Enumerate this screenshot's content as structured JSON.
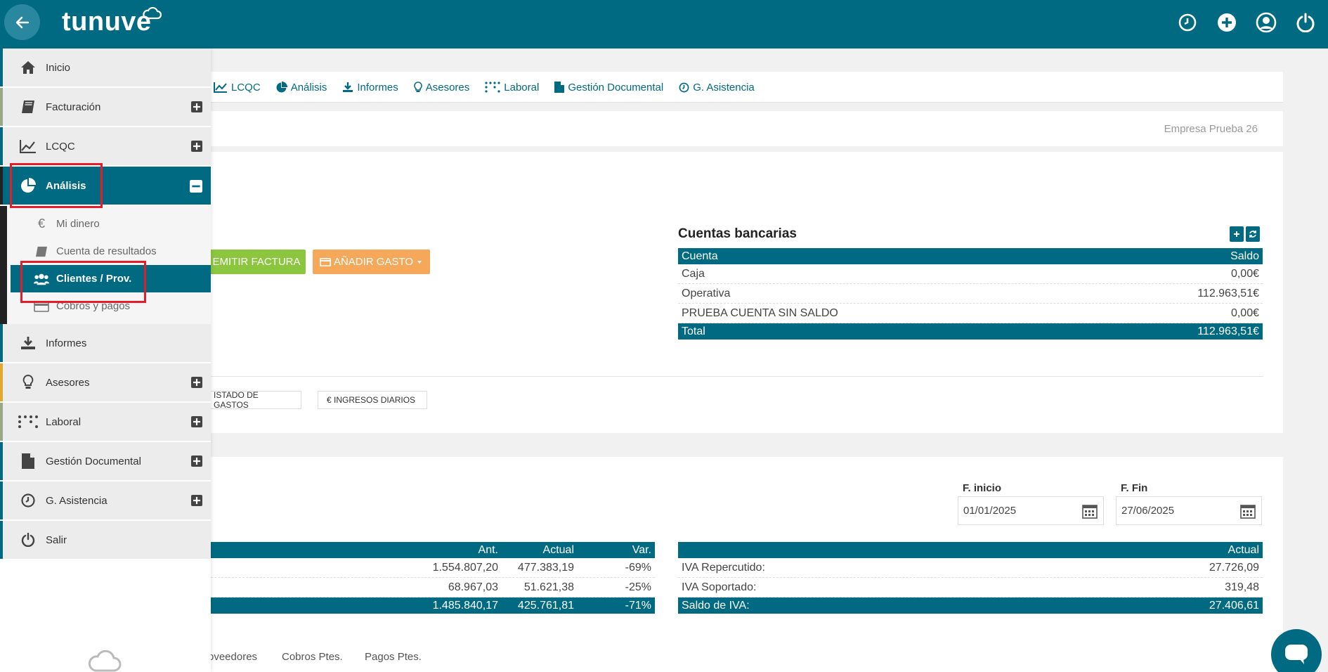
{
  "header": {
    "logo": "tunuve",
    "icons": [
      "clock-icon",
      "plus-circle-icon",
      "user-icon",
      "power-icon"
    ]
  },
  "nav": {
    "items": [
      {
        "label": "LCQC",
        "icon": "line-chart-icon"
      },
      {
        "label": "Análisis",
        "icon": "pie-chart-icon"
      },
      {
        "label": "Informes",
        "icon": "download-icon"
      },
      {
        "label": "Asesores",
        "icon": "lightbulb-icon"
      },
      {
        "label": "Laboral",
        "icon": "dots-grid-icon"
      },
      {
        "label": "Gestión Documental",
        "icon": "document-icon"
      },
      {
        "label": "G. Asistencia",
        "icon": "clock-icon"
      }
    ]
  },
  "company": {
    "name": "Empresa Prueba 26"
  },
  "actions": {
    "emitir": "EMITIR FACTURA",
    "gasto": "AÑADIR GASTO",
    "listado": "ISTADO DE GASTOS",
    "ingresos": "€ INGRESOS DIARIOS"
  },
  "bank": {
    "title": "Cuentas bancarias",
    "headers": {
      "cuenta": "Cuenta",
      "saldo": "Saldo"
    },
    "rows": [
      {
        "cuenta": "Caja",
        "saldo": "0,00€"
      },
      {
        "cuenta": "Operativa",
        "saldo": "112.963,51€"
      },
      {
        "cuenta": "PRUEBA CUENTA SIN SALDO",
        "saldo": "0,00€"
      }
    ],
    "total": {
      "label": "Total",
      "saldo": "112.963,51€"
    }
  },
  "dates": {
    "inicio_label": "F. inicio",
    "inicio_value": "01/01/2025",
    "fin_label": "F. Fin",
    "fin_value": "27/06/2025"
  },
  "comparison": {
    "headers": {
      "ant": "Ant.",
      "actual": "Actual",
      "var": "Var."
    },
    "rows": [
      {
        "ant": "1.554.807,20",
        "actual": "477.383,19",
        "var": "-69%"
      },
      {
        "ant": "68.967,03",
        "actual": "51.621,38",
        "var": "-25%"
      }
    ],
    "total": {
      "ant": "1.485.840,17",
      "actual": "425.761,81",
      "var": "-71%"
    }
  },
  "iva": {
    "header": "Actual",
    "rows": [
      {
        "label": "IVA Repercutido:",
        "value": "27.726,09"
      },
      {
        "label": "IVA Soportado:",
        "value": "319,48"
      }
    ],
    "total": {
      "label": "Saldo de IVA:",
      "value": "27.406,61"
    }
  },
  "tabs": [
    "oveedores",
    "Cobros Ptes.",
    "Pagos Ptes."
  ],
  "sidebar": {
    "items": [
      {
        "label": "Inicio",
        "icon": "home-icon",
        "color": "#006a82"
      },
      {
        "label": "Facturación",
        "icon": "book-icon",
        "color": "#9aa88a"
      },
      {
        "label": "LCQC",
        "icon": "line-chart-icon",
        "color": "#006a82"
      },
      {
        "label": "Análisis",
        "icon": "pie-chart-icon",
        "color": "#222222"
      },
      {
        "label": "Informes",
        "icon": "download-icon",
        "color": "#006a82"
      },
      {
        "label": "Asesores",
        "icon": "lightbulb-icon",
        "color": "#e0a82e"
      },
      {
        "label": "Laboral",
        "icon": "dots-grid-icon",
        "color": "#9aa88a"
      },
      {
        "label": "Gestión Documental",
        "icon": "document-icon",
        "color": "#006a82"
      },
      {
        "label": "G. Asistencia",
        "icon": "clock-icon",
        "color": "#006a82"
      },
      {
        "label": "Salir",
        "icon": "power-icon",
        "color": "#006a82"
      }
    ],
    "subitems": [
      {
        "label": "Mi dinero",
        "icon": "euro-icon"
      },
      {
        "label": "Cuenta de resultados",
        "icon": "book-icon"
      },
      {
        "label": "Clientes / Prov.",
        "icon": "users-icon"
      },
      {
        "label": "Cobros y pagos",
        "icon": "card-icon"
      }
    ]
  }
}
